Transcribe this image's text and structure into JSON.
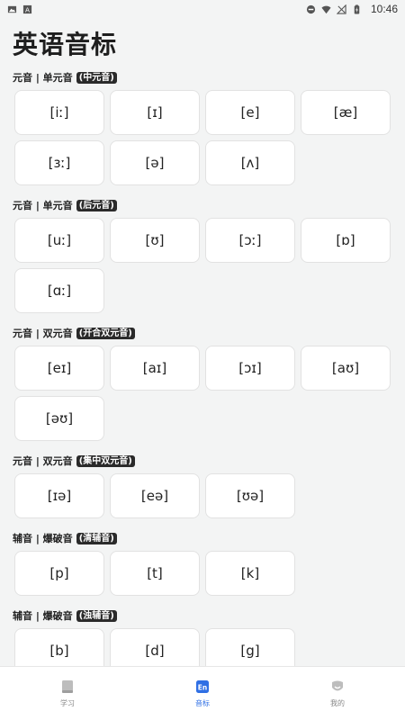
{
  "status_bar": {
    "time": "10:46"
  },
  "page": {
    "title": "英语音标"
  },
  "sections": [
    {
      "title": "元音 | 单元音",
      "tag": "(中元音)",
      "symbols": [
        "[iː]",
        "[ɪ]",
        "[e]",
        "[æ]",
        "[ɜː]",
        "[ə]",
        "[ʌ]"
      ]
    },
    {
      "title": "元音 | 单元音",
      "tag": "(后元音)",
      "symbols": [
        "[uː]",
        "[ʊ]",
        "[ɔː]",
        "[ɒ]",
        "[ɑː]"
      ]
    },
    {
      "title": "元音 | 双元音",
      "tag": "(开合双元音)",
      "symbols": [
        "[eɪ]",
        "[aɪ]",
        "[ɔɪ]",
        "[aʊ]",
        "[əʊ]"
      ]
    },
    {
      "title": "元音 | 双元音",
      "tag": "(集中双元音)",
      "symbols": [
        "[ɪə]",
        "[eə]",
        "[ʊə]"
      ]
    },
    {
      "title": "辅音 | 爆破音",
      "tag": "(清辅音)",
      "symbols": [
        "[p]",
        "[t]",
        "[k]"
      ]
    },
    {
      "title": "辅音 | 爆破音",
      "tag": "(浊辅音)",
      "symbols": [
        "[b]",
        "[d]",
        "[g]"
      ]
    }
  ],
  "tabs": [
    {
      "label": "学习",
      "icon": "book-icon",
      "active": false
    },
    {
      "label": "音标",
      "icon": "en-icon",
      "active": true
    },
    {
      "label": "我的",
      "icon": "profile-icon",
      "active": false
    }
  ],
  "colors": {
    "accent": "#2f6fe4",
    "background": "#f3f4f4"
  }
}
